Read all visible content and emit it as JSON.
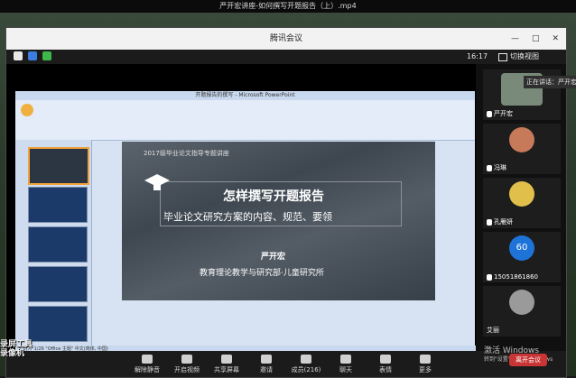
{
  "player": {
    "title": "严开宏讲座-如何撰写开题报告（上）.mp4"
  },
  "window": {
    "title": "腾讯会议",
    "ctrl_minimize": "—",
    "ctrl_maximize": "□",
    "ctrl_close": "✕"
  },
  "status": {
    "time": "16:17",
    "switch_view": "切换视图"
  },
  "ppt": {
    "title": "开题报告的撰写 - Microsoft PowerPoint",
    "status_text": "幻灯片 1/26   \"Office 主题\"   中文(简体, 中国)"
  },
  "slide": {
    "header": "2017级毕业论文指导专题讲座",
    "title": "怎样撰写开题报告",
    "subtitle": "毕业论文研究方案的内容、规范、要领",
    "author": "严开宏",
    "affiliation": "教育理论教学与研究部·儿童研究所"
  },
  "sidebar": {
    "speaking_label": "正在讲话：严开宏",
    "participants": [
      {
        "name": "严开宏",
        "avatar_color": "#7a8a7a"
      },
      {
        "name": "冯琳",
        "avatar_color": "#c77a5a"
      },
      {
        "name": "孔雁妍",
        "avatar_color": "#e0c04a"
      },
      {
        "name": "15051861860",
        "avatar_text": "60",
        "avatar_color": "#1e73d9"
      },
      {
        "name": "艾丽",
        "avatar_color": "#9a9a9a"
      }
    ]
  },
  "toolbar": {
    "items": [
      {
        "label": "解除静音"
      },
      {
        "label": "开启视频"
      },
      {
        "label": "共享屏幕"
      },
      {
        "label": "邀请"
      },
      {
        "label": "成员(216)"
      },
      {
        "label": "聊天"
      },
      {
        "label": "表情"
      },
      {
        "label": "更多"
      }
    ],
    "leave": "离开会议"
  },
  "overlays": {
    "watermark_line1": "录屏工具",
    "watermark_line2": "录像机",
    "activate_line1": "激活 Windows",
    "activate_line2": "转到\"设置\"以激活 Windows"
  },
  "colors": {
    "accent_red": "#c93434",
    "accent_blue": "#1e73d9"
  }
}
